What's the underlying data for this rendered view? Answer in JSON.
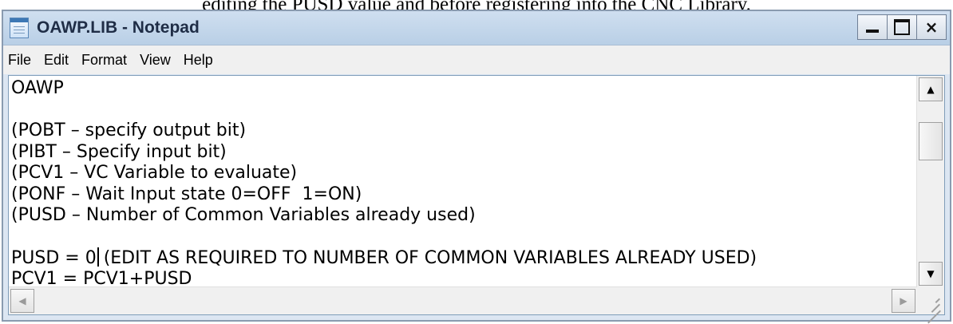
{
  "caption_text": "editing the PUSD value and before registering into the CNC Library.",
  "window": {
    "title": "OAWP.LIB - Notepad",
    "icon": "notepad-icon",
    "controls": {
      "minimize": "minimize-icon",
      "maximize": "maximize-icon",
      "close": "×"
    }
  },
  "menu": {
    "items": [
      "File",
      "Edit",
      "Format",
      "View",
      "Help"
    ]
  },
  "editor": {
    "lines": [
      "OAWP",
      "",
      "(POBT – specify output bit)",
      "(PIBT – Specify input bit)",
      "(PCV1 – VC Variable to evaluate)",
      "(PONF – Wait Input state 0=OFF  1=ON)",
      "(PUSD – Number of Common Variables already used)",
      "",
      "PUSD = 0",
      "PCV1 = PCV1+PUSD"
    ],
    "cursor_line_rest": " (EDIT AS REQUIRED TO NUMBER OF COMMON VARIABLES ALREADY USED)"
  },
  "scrollbars": {
    "up": "▲",
    "down": "▼",
    "left": "◀",
    "right": "▶"
  }
}
